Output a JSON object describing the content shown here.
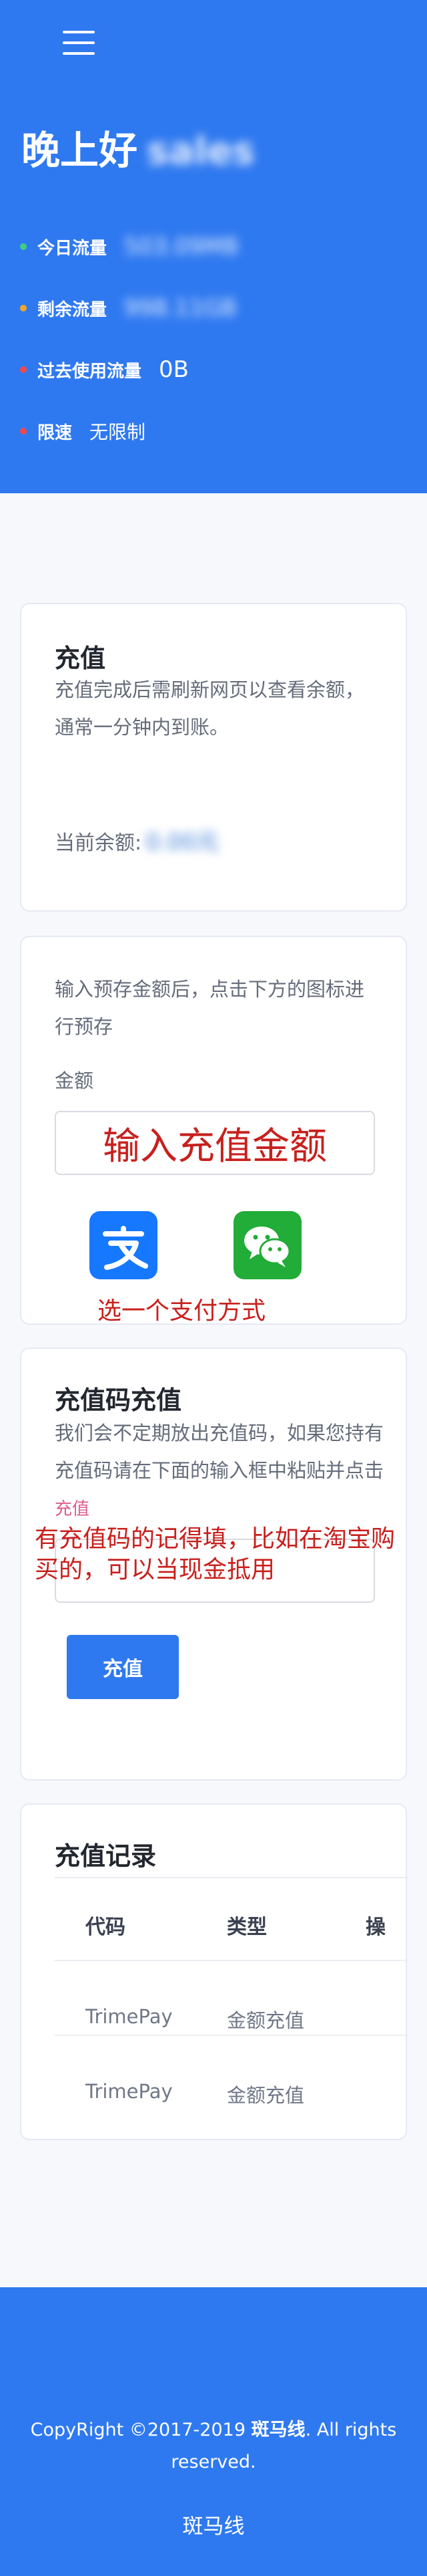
{
  "hero": {
    "greeting": "晚上好",
    "username": "sales",
    "stats": [
      {
        "label": "今日流量",
        "value": "503.09MB",
        "dot_color": "#3ed07e"
      },
      {
        "label": "剩余流量",
        "value": "998.11GB",
        "dot_color": "#f6a623"
      },
      {
        "label": "过去使用流量",
        "value": "0B",
        "dot_color": "#f5474a"
      },
      {
        "label": "限速",
        "value": "无限制",
        "dot_color": "#f5474a"
      }
    ]
  },
  "recharge": {
    "title": "充值",
    "desc": "充值完成后需刷新网页以查看余额，通常一分钟内到账。",
    "balance_label": "当前余额:",
    "balance_value": "0.00元"
  },
  "prepay": {
    "desc": "输入预存金额后，点击下方的图标进行预存",
    "amount_label": "金额",
    "amount_annotation": "输入充值金额",
    "alipay_icon": "alipay-icon",
    "wechat_icon": "wechat-pay-icon",
    "pay_annotation": "选一个支付方式",
    "alipay_color": "#1677ff",
    "wechat_color": "#22ac38"
  },
  "code": {
    "title": "充值码充值",
    "desc": "我们会不定期放出充值码，如果您持有充值码请在下面的输入框中粘贴并点击",
    "desc_link": "充值",
    "annotation": "有充值码的记得填，比如在淘宝购买的，可以当现金抵用",
    "button": "充值"
  },
  "history": {
    "title": "充值记录",
    "columns": [
      "代码",
      "类型",
      "操"
    ],
    "rows": [
      {
        "code": "TrimePay",
        "type": "金额充值"
      },
      {
        "code": "TrimePay",
        "type": "金额充值"
      }
    ]
  },
  "footer": {
    "copyright_prefix": "CopyRight ©2017-2019 ",
    "copyright_brand": "斑马线",
    "copyright_suffix": ". All rights reserved.",
    "brand": "斑马线"
  }
}
